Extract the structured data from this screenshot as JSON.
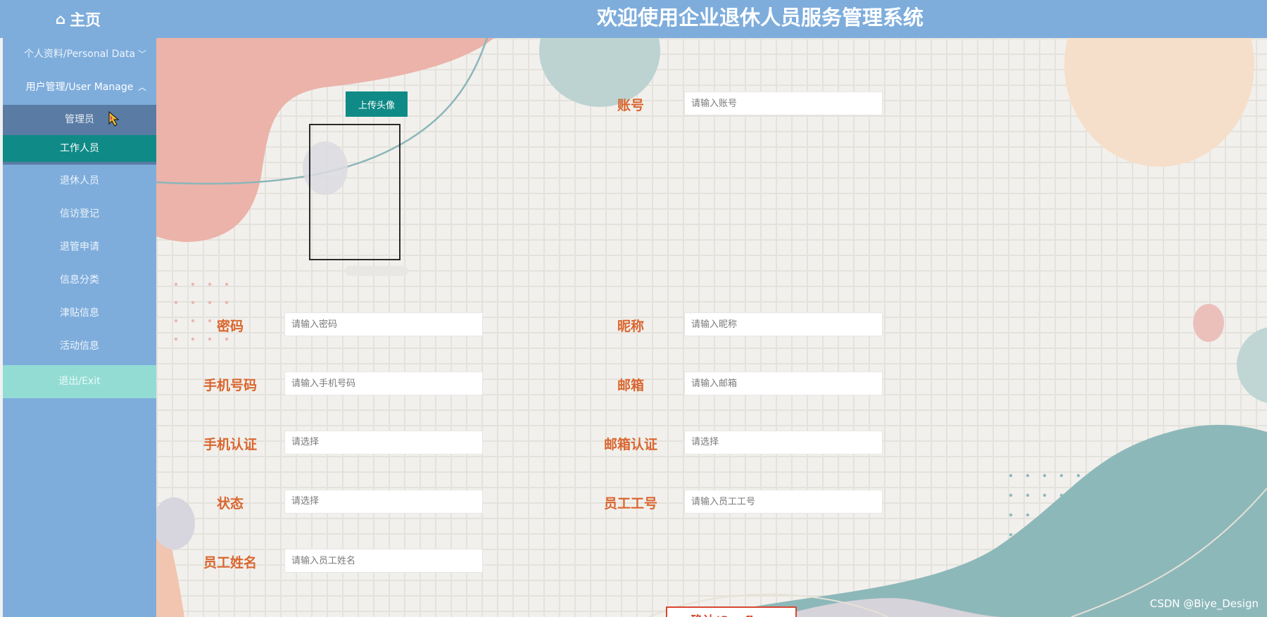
{
  "header": {
    "home_label": "主页",
    "title": "欢迎使用企业退休人员服务管理系统"
  },
  "sidebar": {
    "items": [
      {
        "id": "personal",
        "label": "个人资料/Personal Data",
        "icon": "chevron-down-icon"
      },
      {
        "id": "user",
        "label": "用户管理/User Manage",
        "icon": "chevron-up-icon"
      },
      {
        "id": "admin",
        "label": "管理员"
      },
      {
        "id": "staff",
        "label": "工作人员",
        "active": true
      },
      {
        "id": "retiree",
        "label": "退休人员"
      },
      {
        "id": "petition",
        "label": "信访登记"
      },
      {
        "id": "retire_apply",
        "label": "退管申请"
      },
      {
        "id": "info_cat",
        "label": "信息分类"
      },
      {
        "id": "subsidy",
        "label": "津贴信息"
      },
      {
        "id": "activity",
        "label": "活动信息"
      },
      {
        "id": "exit",
        "label": "退出/Exit"
      }
    ]
  },
  "form": {
    "upload_label": "上传头像",
    "account": {
      "label": "账号",
      "placeholder": "请输入账号"
    },
    "password": {
      "label": "密码",
      "placeholder": "请输入密码"
    },
    "nickname": {
      "label": "昵称",
      "placeholder": "请输入昵称"
    },
    "phone": {
      "label": "手机号码",
      "placeholder": "请输入手机号码"
    },
    "email": {
      "label": "邮箱",
      "placeholder": "请输入邮箱"
    },
    "phone_verify": {
      "label": "手机认证",
      "placeholder": "请选择"
    },
    "email_verify": {
      "label": "邮箱认证",
      "placeholder": "请选择"
    },
    "status": {
      "label": "状态",
      "placeholder": "请选择"
    },
    "staff_no": {
      "label": "员工工号",
      "placeholder": "请输入员工工号"
    },
    "staff_name": {
      "label": "员工姓名",
      "placeholder": "请输入员工姓名"
    },
    "confirm_label": "确认/Confirm"
  },
  "watermark": "CSDN @Biye_Design",
  "colors": {
    "header": "#7eaddc",
    "sidebar_active": "#0f8a87",
    "sidebar_selected": "#5a7ba4",
    "exit_bg": "#93dcd4",
    "label": "#d9662f"
  }
}
